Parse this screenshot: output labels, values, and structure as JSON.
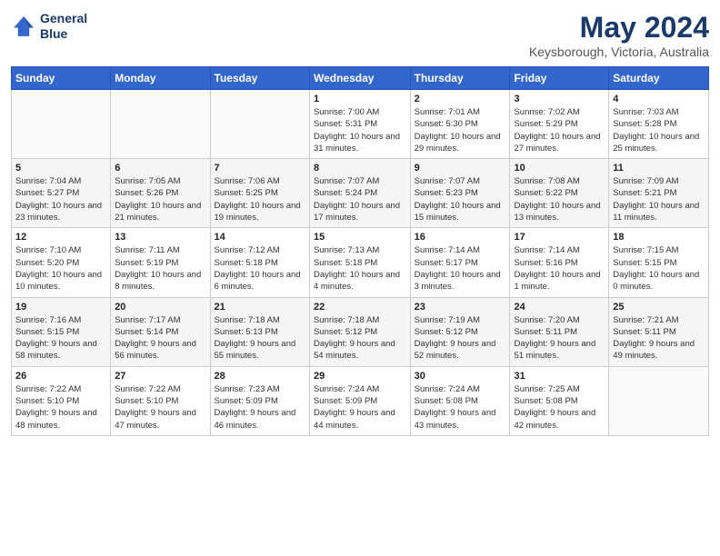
{
  "logo": {
    "line1": "General",
    "line2": "Blue"
  },
  "title": "May 2024",
  "subtitle": "Keysborough, Victoria, Australia",
  "weekdays": [
    "Sunday",
    "Monday",
    "Tuesday",
    "Wednesday",
    "Thursday",
    "Friday",
    "Saturday"
  ],
  "weeks": [
    [
      {
        "day": "",
        "info": ""
      },
      {
        "day": "",
        "info": ""
      },
      {
        "day": "",
        "info": ""
      },
      {
        "day": "1",
        "info": "Sunrise: 7:00 AM\nSunset: 5:31 PM\nDaylight: 10 hours and 31 minutes."
      },
      {
        "day": "2",
        "info": "Sunrise: 7:01 AM\nSunset: 5:30 PM\nDaylight: 10 hours and 29 minutes."
      },
      {
        "day": "3",
        "info": "Sunrise: 7:02 AM\nSunset: 5:29 PM\nDaylight: 10 hours and 27 minutes."
      },
      {
        "day": "4",
        "info": "Sunrise: 7:03 AM\nSunset: 5:28 PM\nDaylight: 10 hours and 25 minutes."
      }
    ],
    [
      {
        "day": "5",
        "info": "Sunrise: 7:04 AM\nSunset: 5:27 PM\nDaylight: 10 hours and 23 minutes."
      },
      {
        "day": "6",
        "info": "Sunrise: 7:05 AM\nSunset: 5:26 PM\nDaylight: 10 hours and 21 minutes."
      },
      {
        "day": "7",
        "info": "Sunrise: 7:06 AM\nSunset: 5:25 PM\nDaylight: 10 hours and 19 minutes."
      },
      {
        "day": "8",
        "info": "Sunrise: 7:07 AM\nSunset: 5:24 PM\nDaylight: 10 hours and 17 minutes."
      },
      {
        "day": "9",
        "info": "Sunrise: 7:07 AM\nSunset: 5:23 PM\nDaylight: 10 hours and 15 minutes."
      },
      {
        "day": "10",
        "info": "Sunrise: 7:08 AM\nSunset: 5:22 PM\nDaylight: 10 hours and 13 minutes."
      },
      {
        "day": "11",
        "info": "Sunrise: 7:09 AM\nSunset: 5:21 PM\nDaylight: 10 hours and 11 minutes."
      }
    ],
    [
      {
        "day": "12",
        "info": "Sunrise: 7:10 AM\nSunset: 5:20 PM\nDaylight: 10 hours and 10 minutes."
      },
      {
        "day": "13",
        "info": "Sunrise: 7:11 AM\nSunset: 5:19 PM\nDaylight: 10 hours and 8 minutes."
      },
      {
        "day": "14",
        "info": "Sunrise: 7:12 AM\nSunset: 5:18 PM\nDaylight: 10 hours and 6 minutes."
      },
      {
        "day": "15",
        "info": "Sunrise: 7:13 AM\nSunset: 5:18 PM\nDaylight: 10 hours and 4 minutes."
      },
      {
        "day": "16",
        "info": "Sunrise: 7:14 AM\nSunset: 5:17 PM\nDaylight: 10 hours and 3 minutes."
      },
      {
        "day": "17",
        "info": "Sunrise: 7:14 AM\nSunset: 5:16 PM\nDaylight: 10 hours and 1 minute."
      },
      {
        "day": "18",
        "info": "Sunrise: 7:15 AM\nSunset: 5:15 PM\nDaylight: 10 hours and 0 minutes."
      }
    ],
    [
      {
        "day": "19",
        "info": "Sunrise: 7:16 AM\nSunset: 5:15 PM\nDaylight: 9 hours and 58 minutes."
      },
      {
        "day": "20",
        "info": "Sunrise: 7:17 AM\nSunset: 5:14 PM\nDaylight: 9 hours and 56 minutes."
      },
      {
        "day": "21",
        "info": "Sunrise: 7:18 AM\nSunset: 5:13 PM\nDaylight: 9 hours and 55 minutes."
      },
      {
        "day": "22",
        "info": "Sunrise: 7:18 AM\nSunset: 5:12 PM\nDaylight: 9 hours and 54 minutes."
      },
      {
        "day": "23",
        "info": "Sunrise: 7:19 AM\nSunset: 5:12 PM\nDaylight: 9 hours and 52 minutes."
      },
      {
        "day": "24",
        "info": "Sunrise: 7:20 AM\nSunset: 5:11 PM\nDaylight: 9 hours and 51 minutes."
      },
      {
        "day": "25",
        "info": "Sunrise: 7:21 AM\nSunset: 5:11 PM\nDaylight: 9 hours and 49 minutes."
      }
    ],
    [
      {
        "day": "26",
        "info": "Sunrise: 7:22 AM\nSunset: 5:10 PM\nDaylight: 9 hours and 48 minutes."
      },
      {
        "day": "27",
        "info": "Sunrise: 7:22 AM\nSunset: 5:10 PM\nDaylight: 9 hours and 47 minutes."
      },
      {
        "day": "28",
        "info": "Sunrise: 7:23 AM\nSunset: 5:09 PM\nDaylight: 9 hours and 46 minutes."
      },
      {
        "day": "29",
        "info": "Sunrise: 7:24 AM\nSunset: 5:09 PM\nDaylight: 9 hours and 44 minutes."
      },
      {
        "day": "30",
        "info": "Sunrise: 7:24 AM\nSunset: 5:08 PM\nDaylight: 9 hours and 43 minutes."
      },
      {
        "day": "31",
        "info": "Sunrise: 7:25 AM\nSunset: 5:08 PM\nDaylight: 9 hours and 42 minutes."
      },
      {
        "day": "",
        "info": ""
      }
    ]
  ]
}
